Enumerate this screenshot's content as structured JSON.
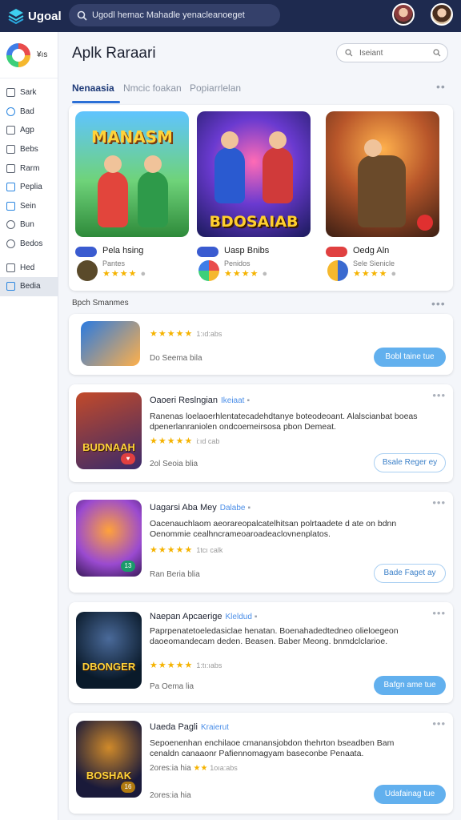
{
  "app": {
    "name": "Ugoal",
    "search_text": "Ugodl hemac Mahadle yenacleanoeget"
  },
  "sidebar": {
    "user_label": "¥ıs",
    "items": [
      {
        "label": "Sark",
        "icon": "square-icon"
      },
      {
        "label": "Bad",
        "icon": "gear-icon"
      },
      {
        "label": "Agp",
        "icon": "box-icon"
      },
      {
        "label": "Bebs",
        "icon": "chat-icon"
      },
      {
        "label": "Rarm",
        "icon": "calendar-icon"
      },
      {
        "label": "Peplia",
        "icon": "folder-icon"
      },
      {
        "label": "Sein",
        "icon": "image-icon"
      },
      {
        "label": "Bun",
        "icon": "clock-icon"
      },
      {
        "label": "Bedos",
        "icon": "settings-icon"
      },
      {
        "label": "Hed",
        "icon": "inbox-icon"
      },
      {
        "label": "Bedia",
        "icon": "media-icon",
        "active": true
      }
    ]
  },
  "main": {
    "title": "Aplk Raraari",
    "search_placeholder": "Iseiant",
    "tabs": [
      "Nenaasia",
      "Nmcic foakan",
      "Popiarrlelan"
    ]
  },
  "featured": [
    {
      "art_title": "MANASM",
      "name": "Pela hsing",
      "sub": "Pantes",
      "stars": "★★★★",
      "badge_color": "#3a5bd0",
      "icon_color": "#5a4a2a"
    },
    {
      "art_title": "BDOSAIAB",
      "name": "Uasp Bnibs",
      "sub": "Penidos",
      "stars": "★★★★",
      "badge_color": "#3a5bd0",
      "icon_color": "#d0a020"
    },
    {
      "art_title": "",
      "name": "Oedg Aln",
      "sub": "Sele Sienicle",
      "stars": "★★★★",
      "badge_color": "#e04040",
      "icon_color": "#3a6ad0"
    }
  ],
  "section_label": "Bpch Smanmes",
  "list": [
    {
      "title": "",
      "cat": "",
      "desc": "",
      "stars": "★★★★★",
      "count": "1:ıd:abs",
      "meta": "Do Seema bila",
      "button": "Bobl taine tue",
      "btn_style": "solid",
      "thumb_title": "",
      "thumb_colors": "#2a7ae0,#ffb04a",
      "tag": "",
      "tag_color": ""
    },
    {
      "title": "Oaoeri Reslngian",
      "cat": "Ikeiaat",
      "desc": "Ranenas loelaoerhlentatecadehdtanye boteodeoant. Alalscianbat boeas dpenerlanraniolen ondcoemeirsosa  pbon Demeat.",
      "stars": "★★★★★",
      "count": "i:ıd cab",
      "meta": "2ol Seoia blia",
      "button": "Bsale Reger ey",
      "btn_style": "outline",
      "thumb_title": "BUDNAAH",
      "thumb_colors": "#c24a2a,#3a2a6a",
      "tag": "♥",
      "tag_color": "#e04040"
    },
    {
      "title": "Uagarsi Aba Mey",
      "cat": "Dalabe",
      "desc": "Oacenauchlaom aeorareopalcatelhitsan  polrtaadete  d ate  on bdnn Oenommie cealhncrameoaroadeaclovnenplatos.",
      "stars": "★★★★★",
      "count": "1tcı calk",
      "meta": "Ran Beria blia",
      "button": "Bade Faget ay",
      "btn_style": "outline",
      "thumb_title": "",
      "thumb_colors": "#9a4ad0,#ffa23a",
      "tag": "13",
      "tag_color": "#1a9a6a"
    },
    {
      "title": "Naepan Apcaerige",
      "cat": "Kleldud",
      "desc": "Paprpenatetoeledasiclae henatan.  Boenahadedtedneo olieloegeon daoeomandecam deden.  Beasen. Baber Meong. bnmdclclarioe.",
      "stars": "★★★★★",
      "count": "1:tı:ıabs",
      "meta": "Pa Oema lia",
      "button": "Bafgn ame tue",
      "btn_style": "solid",
      "thumb_title": "DBONGER",
      "thumb_colors": "#2a4a7a,#0a1a2a",
      "tag": "",
      "tag_color": ""
    },
    {
      "title": "Uaeda Pagli",
      "cat": "Kraierut",
      "desc": "Sepoenenhan enchilaoe cmanansjobdon thehrton  bseadben Bam cenaldn canaaonr Pafiennomagyam baseconbe Penaata.",
      "stars": "★★",
      "count": "1oıa:abs",
      "meta": "2ores:ia hia",
      "button": "Udafainag tue",
      "btn_style": "solid",
      "thumb_title": "BOSHAK",
      "thumb_colors": "#1a1a3a,#d08a2a",
      "tag": "16",
      "tag_color": "#b07a10"
    }
  ]
}
